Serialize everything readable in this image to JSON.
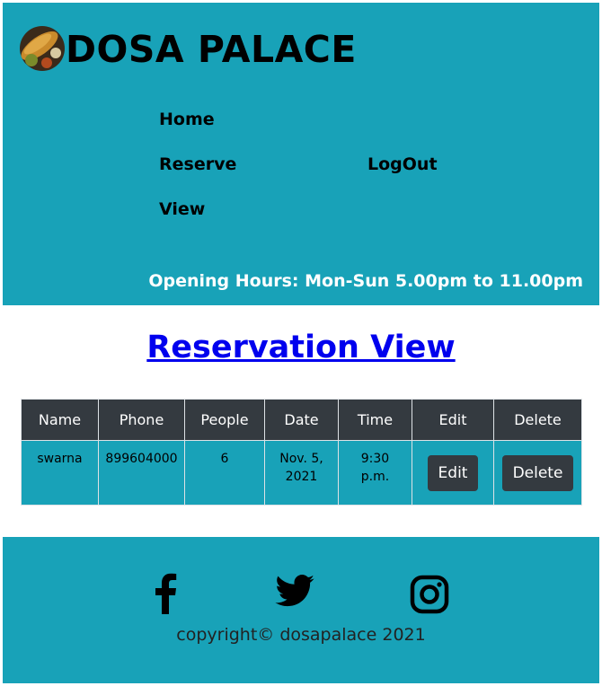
{
  "brand": {
    "name": "DOSA PALACE"
  },
  "nav": {
    "home": "Home",
    "reserve": "Reserve",
    "view": "View",
    "logout": "LogOut"
  },
  "hours": "Opening Hours: Mon-Sun 5.00pm to 11.00pm",
  "page_title": "Reservation View",
  "table": {
    "headers": [
      "Name",
      "Phone",
      "People",
      "Date",
      "Time",
      "Edit",
      "Delete"
    ],
    "rows": [
      {
        "name": "swarna",
        "phone": "899604000",
        "people": "6",
        "date_line1": "Nov. 5,",
        "date_line2": "2021",
        "time_line1": "9:30",
        "time_line2": "p.m.",
        "edit_label": "Edit",
        "delete_label": "Delete"
      }
    ]
  },
  "footer": {
    "social_icons": [
      "facebook-icon",
      "twitter-icon",
      "instagram-icon"
    ],
    "copyright": "copyright© dosapalace 2021"
  },
  "colors": {
    "header_bg": "#18a2b8",
    "dark_button": "#343a40",
    "link": "#0000ee"
  }
}
